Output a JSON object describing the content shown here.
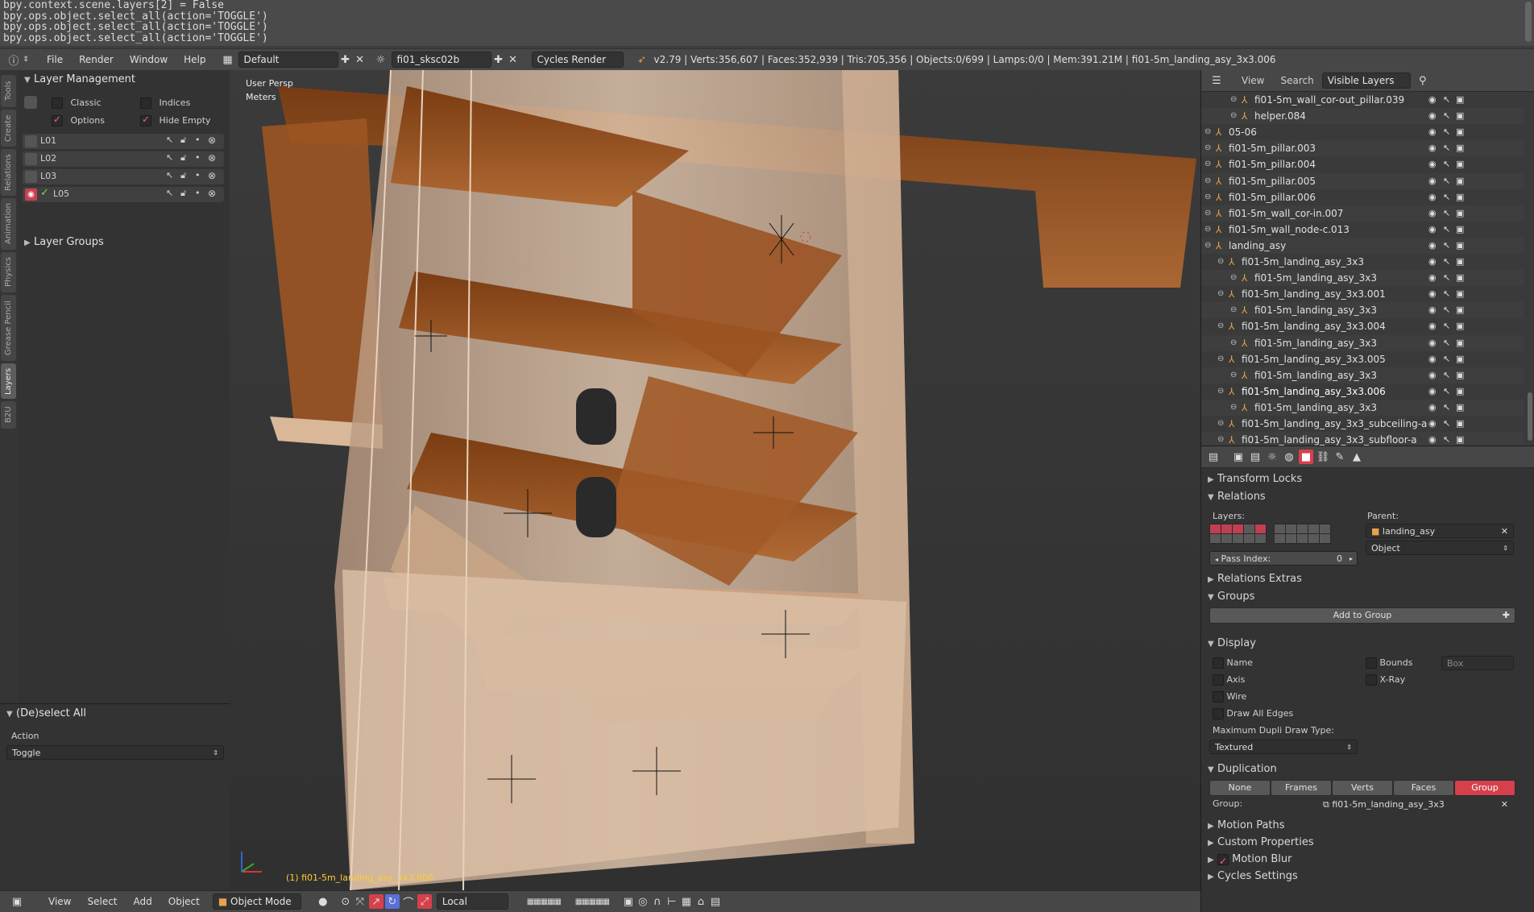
{
  "console": {
    "lines": [
      "bpy.context.scene.layers[2] = False",
      "bpy.ops.object.select_all(action='TOGGLE')",
      "bpy.ops.object.select_all(action='TOGGLE')",
      "bpy.ops.object.select_all(action='TOGGLE')"
    ]
  },
  "topbar": {
    "menus": [
      "File",
      "Render",
      "Window",
      "Help"
    ],
    "layout": "Default",
    "scene": "fi01_sksc02b",
    "engine": "Cycles Render",
    "stats": "v2.79 | Verts:356,607 | Faces:352,939 | Tris:705,356 | Objects:0/699 | Lamps:0/0 | Mem:391.21M | fi01-5m_landing_asy_3x3.006"
  },
  "vtabs": [
    "Tools",
    "Create",
    "Relations",
    "Animation",
    "Physics",
    "Grease Pencil",
    "Layers",
    "B2U"
  ],
  "toolshelf": {
    "layer_mgmt_title": "Layer Management",
    "opt_classic": "Classic",
    "opt_indices": "Indices",
    "opt_options": "Options",
    "opt_hide_empty": "Hide Empty",
    "layers": [
      "L01",
      "L02",
      "L03",
      "L05"
    ],
    "layer_groups_title": "Layer Groups"
  },
  "operator": {
    "title": "(De)select All",
    "action_label": "Action",
    "action_value": "Toggle"
  },
  "viewport": {
    "view_name": "User Persp",
    "units": "Meters",
    "active_object": "(1) fi01-5m_landing_asy_3x3.006"
  },
  "bottombar": {
    "menus": [
      "View",
      "Select",
      "Add",
      "Object"
    ],
    "mode": "Object Mode",
    "orientation": "Local"
  },
  "outliner": {
    "header": {
      "view": "View",
      "search": "Search",
      "display": "Visible Layers"
    },
    "rows": [
      {
        "name": "fi01-5m_wall_cor-out_pillar.039",
        "indent": 3
      },
      {
        "name": "helper.084",
        "indent": 3
      },
      {
        "name": "05-06",
        "indent": 1
      },
      {
        "name": "fi01-5m_pillar.003",
        "indent": 1
      },
      {
        "name": "fi01-5m_pillar.004",
        "indent": 1
      },
      {
        "name": "fi01-5m_pillar.005",
        "indent": 1
      },
      {
        "name": "fi01-5m_pillar.006",
        "indent": 1
      },
      {
        "name": "fi01-5m_wall_cor-in.007",
        "indent": 1
      },
      {
        "name": "fi01-5m_wall_node-c.013",
        "indent": 1
      },
      {
        "name": "landing_asy",
        "indent": 1
      },
      {
        "name": "fi01-5m_landing_asy_3x3",
        "indent": 2
      },
      {
        "name": "fi01-5m_landing_asy_3x3",
        "indent": 3
      },
      {
        "name": "fi01-5m_landing_asy_3x3.001",
        "indent": 2
      },
      {
        "name": "fi01-5m_landing_asy_3x3",
        "indent": 3
      },
      {
        "name": "fi01-5m_landing_asy_3x3.004",
        "indent": 2
      },
      {
        "name": "fi01-5m_landing_asy_3x3",
        "indent": 3
      },
      {
        "name": "fi01-5m_landing_asy_3x3.005",
        "indent": 2
      },
      {
        "name": "fi01-5m_landing_asy_3x3",
        "indent": 3
      },
      {
        "name": "fi01-5m_landing_asy_3x3.006",
        "indent": 2
      },
      {
        "name": "fi01-5m_landing_asy_3x3",
        "indent": 3
      },
      {
        "name": "fi01-5m_landing_asy_3x3_subceiling-a",
        "indent": 2
      },
      {
        "name": "fi01-5m_landing_asy_3x3_subfloor-a",
        "indent": 2
      }
    ]
  },
  "properties": {
    "transform_locks": "Transform Locks",
    "relations": "Relations",
    "layers_label": "Layers:",
    "parent_label": "Parent:",
    "parent_value": "landing_asy",
    "parent_type": "Object",
    "pass_index_label": "Pass Index:",
    "pass_index_value": "0",
    "relations_extras": "Relations Extras",
    "groups": "Groups",
    "add_to_group": "Add to Group",
    "display": "Display",
    "name": "Name",
    "bounds": "Bounds",
    "bounds_type": "Box",
    "axis": "Axis",
    "xray": "X-Ray",
    "wire": "Wire",
    "draw_all_edges": "Draw All Edges",
    "max_dupli_label": "Maximum Dupli Draw Type:",
    "max_dupli_value": "Textured",
    "duplication": "Duplication",
    "dup_none": "None",
    "dup_frames": "Frames",
    "dup_verts": "Verts",
    "dup_faces": "Faces",
    "dup_group": "Group",
    "group_label": "Group:",
    "group_value": "fi01-5m_landing_asy_3x3",
    "motion_paths": "Motion Paths",
    "custom_properties": "Custom Properties",
    "motion_blur": "Motion Blur",
    "cycles_settings": "Cycles Settings"
  }
}
